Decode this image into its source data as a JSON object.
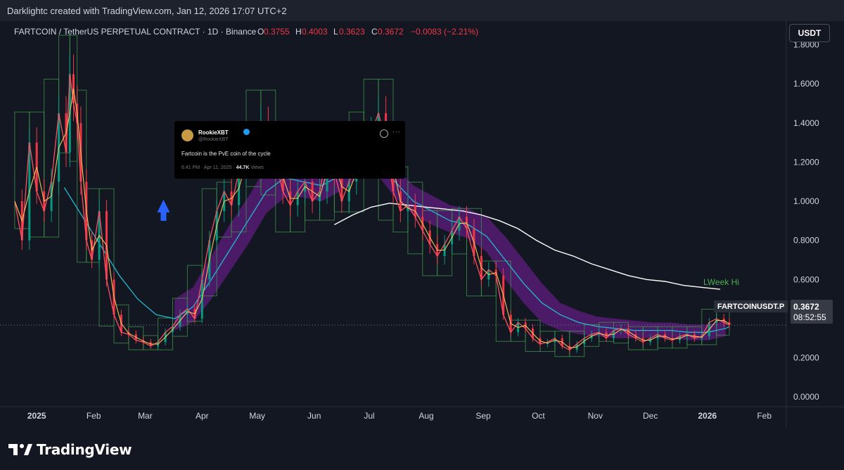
{
  "header": {
    "credit": "Darklightc created with TradingView.com, Jan 12, 2026 17:07 UTC+2"
  },
  "legend": {
    "symbol": "FARTCOIN / TetherUS PERPETUAL CONTRACT · 1D · Binance",
    "o_label": "O",
    "o_value": "0.3755",
    "h_label": "H",
    "h_value": "0.4003",
    "l_label": "L",
    "l_value": "0.3623",
    "c_label": "C",
    "c_value": "0.3672",
    "change": "−0.0083 (−2.21%)"
  },
  "currency_button": "USDT",
  "tweet": {
    "name": "RookieXBT",
    "handle": "@RookieXBT",
    "text": "Fartcoin is the PvE coin of the cycle",
    "time": "6:41 PM · Apr 11, 2025 · ",
    "views": "44.7K",
    "views_label": " Views"
  },
  "price_tag": {
    "symbol": "FARTCOINUSDT.P",
    "price": "0.3672",
    "countdown": "08:52:55"
  },
  "annotations": {
    "week_hi": "LWeek Hi"
  },
  "footer": {
    "brand": "TradingView"
  },
  "colors": {
    "background": "#131722",
    "up": "#089981",
    "down": "#f23645",
    "ma_fast": "#f7525f",
    "ma_mid": "#f5c25b",
    "ema_cyan": "#22b8cf",
    "ma_white": "#ffffff",
    "band": "#7b1fa2",
    "weekly_box": "#3f8f4a",
    "arrow": "#2962ff"
  },
  "chart_data": {
    "type": "line",
    "title": "",
    "xlabel": "",
    "ylabel": "",
    "ylim": [
      -0.05,
      1.82
    ],
    "y_ticks": [
      "1.8000",
      "1.6000",
      "1.4000",
      "1.2000",
      "1.0000",
      "0.8000",
      "0.6000",
      "0.4000",
      "0.2000",
      "0.0000"
    ],
    "x_ticks": [
      "2025",
      "Feb",
      "Mar",
      "Apr",
      "May",
      "Jun",
      "Jul",
      "Aug",
      "Sep",
      "Oct",
      "Nov",
      "Dec",
      "2026",
      "Feb"
    ],
    "grid": false,
    "x_domain_days": [
      -20,
      408
    ],
    "price_series": {
      "name": "price",
      "x": [
        -12,
        -8,
        -4,
        0,
        4,
        8,
        12,
        16,
        18,
        20,
        22,
        24,
        27,
        30,
        34,
        38,
        42,
        46,
        50,
        54,
        58,
        62,
        66,
        70,
        74,
        78,
        82,
        86,
        90,
        94,
        98,
        102,
        106,
        110,
        114,
        118,
        122,
        126,
        130,
        134,
        138,
        142,
        146,
        150,
        154,
        158,
        162,
        166,
        170,
        174,
        178,
        182,
        186,
        190,
        194,
        198,
        202,
        206,
        210,
        214,
        218,
        222,
        226,
        230,
        234,
        238,
        242,
        246,
        250,
        254,
        258,
        262,
        266,
        270,
        274,
        278,
        282,
        286,
        290,
        294,
        298,
        302,
        306,
        310,
        314,
        318,
        322,
        326,
        330,
        334,
        338,
        342,
        346,
        350,
        354,
        358,
        362,
        366,
        370,
        374,
        377
      ],
      "y": [
        1.0,
        0.8,
        1.3,
        1.05,
        0.95,
        1.1,
        1.45,
        1.25,
        1.65,
        1.5,
        1.4,
        1.1,
        0.8,
        0.7,
        0.95,
        0.6,
        0.42,
        0.33,
        0.32,
        0.29,
        0.28,
        0.26,
        0.28,
        0.33,
        0.36,
        0.42,
        0.45,
        0.4,
        0.6,
        0.8,
        0.95,
        1.05,
        0.98,
        1.15,
        1.25,
        1.3,
        1.4,
        1.33,
        1.2,
        1.05,
        0.98,
        1.05,
        1.1,
        1.0,
        1.05,
        1.25,
        1.15,
        1.0,
        1.1,
        1.2,
        1.3,
        1.35,
        1.45,
        1.3,
        1.05,
        0.95,
        0.98,
        0.92,
        0.85,
        0.78,
        0.72,
        0.78,
        0.85,
        0.92,
        0.86,
        0.72,
        0.6,
        0.65,
        0.62,
        0.42,
        0.33,
        0.38,
        0.35,
        0.3,
        0.27,
        0.28,
        0.3,
        0.26,
        0.24,
        0.27,
        0.3,
        0.32,
        0.33,
        0.3,
        0.34,
        0.35,
        0.32,
        0.3,
        0.28,
        0.3,
        0.32,
        0.3,
        0.29,
        0.31,
        0.32,
        0.3,
        0.31,
        0.38,
        0.4,
        0.38,
        0.3672
      ]
    },
    "ema_series": {
      "name": "EMA",
      "x": [
        15,
        25,
        35,
        45,
        55,
        65,
        75,
        85,
        95,
        105,
        115,
        125,
        135,
        145,
        155,
        165,
        175,
        185,
        195,
        205,
        215,
        225,
        235,
        245,
        255,
        265,
        275,
        285,
        295,
        305,
        315,
        325,
        335,
        345,
        355,
        365,
        375,
        377
      ],
      "y": [
        1.07,
        0.92,
        0.77,
        0.62,
        0.5,
        0.42,
        0.4,
        0.46,
        0.6,
        0.75,
        0.9,
        1.05,
        1.12,
        1.1,
        1.08,
        1.13,
        1.2,
        1.22,
        1.1,
        1.0,
        0.95,
        0.9,
        0.88,
        0.82,
        0.7,
        0.58,
        0.48,
        0.42,
        0.38,
        0.36,
        0.35,
        0.34,
        0.34,
        0.34,
        0.33,
        0.33,
        0.35,
        0.36
      ]
    },
    "ma_white_series": {
      "name": "MA",
      "x": [
        162,
        172,
        182,
        192,
        202,
        212,
        222,
        232,
        242,
        252,
        262,
        272,
        282,
        292,
        302,
        312,
        322,
        332,
        342,
        352,
        362,
        372
      ],
      "y": [
        0.88,
        0.93,
        0.97,
        0.99,
        0.98,
        0.97,
        0.96,
        0.95,
        0.93,
        0.9,
        0.86,
        0.8,
        0.75,
        0.72,
        0.68,
        0.65,
        0.62,
        0.6,
        0.59,
        0.57,
        0.56,
        0.55
      ]
    },
    "band_series": {
      "name": "band",
      "x": [
        75,
        85,
        95,
        105,
        115,
        125,
        135,
        145,
        155,
        165,
        175,
        185,
        195,
        205,
        215,
        225,
        235,
        245,
        255,
        265,
        275,
        285,
        295,
        305,
        315,
        325,
        335,
        345,
        355,
        365,
        375
      ],
      "upper": [
        0.5,
        0.56,
        0.72,
        0.88,
        1.02,
        1.18,
        1.22,
        1.18,
        1.16,
        1.21,
        1.3,
        1.28,
        1.18,
        1.08,
        1.03,
        0.98,
        0.96,
        0.92,
        0.82,
        0.7,
        0.58,
        0.48,
        0.44,
        0.41,
        0.4,
        0.39,
        0.38,
        0.38,
        0.37,
        0.37,
        0.39
      ],
      "lower": [
        0.34,
        0.38,
        0.5,
        0.64,
        0.78,
        0.94,
        1.02,
        1.02,
        1.0,
        1.05,
        1.12,
        1.14,
        1.02,
        0.93,
        0.88,
        0.84,
        0.81,
        0.74,
        0.6,
        0.48,
        0.38,
        0.34,
        0.32,
        0.31,
        0.3,
        0.3,
        0.3,
        0.3,
        0.29,
        0.29,
        0.31
      ]
    },
    "price_line": 0.3672
  }
}
